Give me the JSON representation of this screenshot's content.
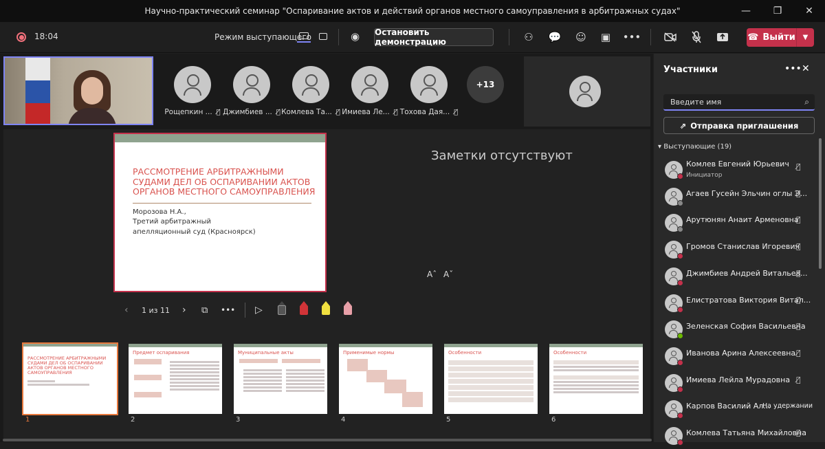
{
  "window": {
    "title": "Научно-практический семинар \"Оспаривание актов и действий органов местного самоуправления в арбитражных судах\"",
    "minimize": "—",
    "maximize": "❐",
    "close": "✕"
  },
  "toolbar": {
    "timer": "18:04",
    "mode_label": "Режим выступающего",
    "stop_label": "Остановить демонстрацию",
    "leave_label": "Выйти"
  },
  "participants_strip": [
    {
      "name": "Рощепкин ..."
    },
    {
      "name": "Джимбиев ..."
    },
    {
      "name": "Комлева Та..."
    },
    {
      "name": "Имиева Ле..."
    },
    {
      "name": "Тохова Дая..."
    }
  ],
  "more_count": "+13",
  "slide": {
    "title": "РАССМОТРЕНИЕ АРБИТРАЖНЫМИ СУДАМИ ДЕЛ ОБ ОСПАРИВАНИИ АКТОВ ОРГАНОВ МЕСТНОГО САМОУПРАВЛЕНИЯ",
    "author": "Морозова Н.А.,",
    "org": "Третий арбитражный апелляционный суд (Красноярск)"
  },
  "notes_text": "Заметки отсутствуют",
  "font_increase": "Aˆ",
  "font_decrease": "Aˇ",
  "slide_counter": "1 из 11",
  "thumbnails": [
    {
      "num": "1",
      "title": "РАССМОТРЕНИЕ АРБИТРАЖНЫМИ СУДАМИ ДЕЛ ОБ ОСПАРИВАНИИ АКТОВ ОРГАНОВ МЕСТНОГО САМОУПРАВЛЕНИЯ"
    },
    {
      "num": "2",
      "title": "Предмет оспаривания"
    },
    {
      "num": "3",
      "title": "Муниципальные акты"
    },
    {
      "num": "4",
      "title": "Применимые нормы"
    },
    {
      "num": "5",
      "title": "Особенности"
    },
    {
      "num": "6",
      "title": "Особенности"
    }
  ],
  "panel": {
    "title": "Участники",
    "search_placeholder": "Введите имя",
    "invite_label": "Отправка приглашения",
    "section_label": "Выступающие (19)",
    "people": [
      {
        "name": "Комлев Евгений Юрьевич",
        "role": "Инициатор",
        "status_color": "#c4314b"
      },
      {
        "name": "Агаев Гусейн Эльчин оглы Э...",
        "role": "",
        "status_color": "#888888"
      },
      {
        "name": "Арутюнян Анаит Арменовна",
        "role": "",
        "status_color": "#888888"
      },
      {
        "name": "Громов Станислав Игоревич",
        "role": "",
        "status_color": "#c4314b"
      },
      {
        "name": "Джимбиев Андрей Витальев...",
        "role": "",
        "status_color": "#c4314b"
      },
      {
        "name": "Елистратова Виктория Витал...",
        "role": "",
        "status_color": "#c4314b"
      },
      {
        "name": "Зеленская София Васильевна",
        "role": "",
        "status_color": "#6bb700"
      },
      {
        "name": "Иванова Арина Алексеевна",
        "role": "",
        "status_color": "#c4314b"
      },
      {
        "name": "Имиева Лейла Мурадовна",
        "role": "",
        "status_color": "#c4314b"
      },
      {
        "name": "Карпов Василий Ал...",
        "role": "",
        "status_color": "#c4314b",
        "hold": "На удержании"
      },
      {
        "name": "Комлева Татьяна Михайловна",
        "role": "",
        "status_color": "#c4314b"
      }
    ]
  }
}
